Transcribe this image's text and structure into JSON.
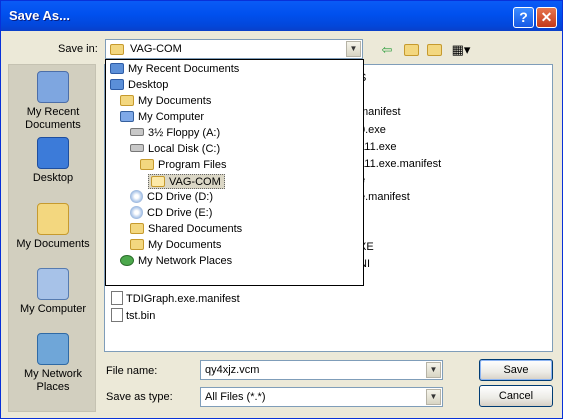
{
  "window": {
    "title": "Save As...",
    "help_label": "?",
    "close_label": "✕"
  },
  "save_in": {
    "label": "Save in:",
    "value": "VAG-COM"
  },
  "toolbar": {
    "back_icon": "back-arrow-icon",
    "up_icon": "up-folder-icon",
    "new_folder_icon": "new-folder-icon",
    "views_icon": "views-menu-icon"
  },
  "places": [
    {
      "label": "My Recent Documents",
      "icon": "recent-documents-icon"
    },
    {
      "label": "Desktop",
      "icon": "desktop-icon"
    },
    {
      "label": "My Documents",
      "icon": "my-documents-icon"
    },
    {
      "label": "My Computer",
      "icon": "my-computer-icon"
    },
    {
      "label": "My Network Places",
      "icon": "network-places-icon"
    }
  ],
  "dropdown_items": [
    {
      "label": "My Recent Documents",
      "icon": "recent-documents-icon",
      "level": 0
    },
    {
      "label": "Desktop",
      "icon": "desktop-icon",
      "level": 0
    },
    {
      "label": "My Documents",
      "icon": "folder-icon",
      "level": 1
    },
    {
      "label": "My Computer",
      "icon": "my-computer-icon",
      "level": 1
    },
    {
      "label": "3½ Floppy (A:)",
      "icon": "floppy-icon",
      "level": 2
    },
    {
      "label": "Local Disk (C:)",
      "icon": "hard-disk-icon",
      "level": 2
    },
    {
      "label": "Program Files",
      "icon": "folder-icon",
      "level": 3
    },
    {
      "label": "VAG-COM",
      "icon": "open-folder-icon",
      "level": 4,
      "selected": true
    },
    {
      "label": "CD Drive (D:)",
      "icon": "cd-drive-icon",
      "level": 2
    },
    {
      "label": "CD Drive (E:)",
      "icon": "cd-drive-icon",
      "level": 2
    },
    {
      "label": "Shared Documents",
      "icon": "folder-icon",
      "level": 2
    },
    {
      "label": "My Documents",
      "icon": "folder-icon",
      "level": 2
    },
    {
      "label": "My Network Places",
      "icon": "network-places-icon",
      "level": 1
    }
  ],
  "files_partial": [
    {
      "text": "S"
    },
    {
      "text": "manifest"
    },
    {
      "text": "0.exe"
    },
    {
      "text": "111.exe"
    },
    {
      "text": "111.exe.manifest"
    },
    {
      "text": "e"
    },
    {
      "text": "e.manifest"
    },
    {
      "text": "XE"
    },
    {
      "text": "NI"
    }
  ],
  "files": [
    {
      "name": "TDIGraph.exe.manifest",
      "icon": "manifest-file-icon"
    },
    {
      "name": "tst.bin",
      "icon": "bin-file-icon"
    }
  ],
  "file_name": {
    "label": "File name:",
    "value": "qy4xjz.vcm"
  },
  "save_as_type": {
    "label": "Save as type:",
    "value": "All Files (*.*)"
  },
  "buttons": {
    "save": "Save",
    "cancel": "Cancel"
  }
}
